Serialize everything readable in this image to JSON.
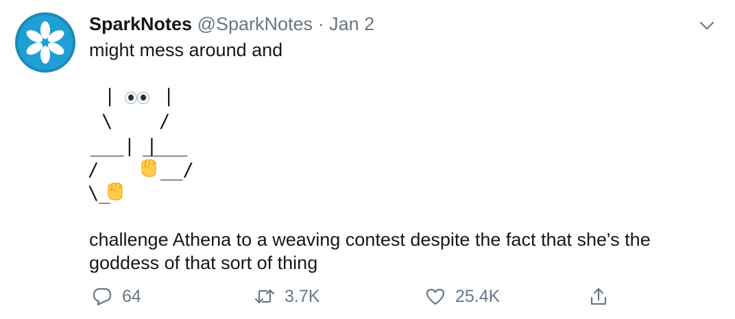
{
  "tweet": {
    "display_name": "SparkNotes",
    "handle": "@SparkNotes",
    "separator": "·",
    "date": "Jan 2",
    "text_top": "might mess around and",
    "text_bottom": "challenge Athena to a weaving contest despite the fact that she's the goddess of that sort of thing",
    "avatar_icon": "sparknotes-logo-icon",
    "accent_color": "#1da1f2"
  },
  "ascii_art": {
    "line1_left": "|",
    "line1_right": "|",
    "line2_left": "\\",
    "line2_right": "/",
    "line3_left": "___| |",
    "line3_right": "____",
    "line4_left": "/",
    "line4_right": "__/",
    "line5_left": "\\_",
    "emojis": [
      "eyes-emoji",
      "raised-fist-emoji",
      "raised-fist-emoji"
    ]
  },
  "actions": {
    "reply_count": "64",
    "retweet_count": "3.7K",
    "like_count": "25.4K",
    "icons": [
      "reply-icon",
      "retweet-icon",
      "like-icon",
      "share-icon"
    ]
  },
  "menu": {
    "icon": "chevron-down-icon"
  }
}
